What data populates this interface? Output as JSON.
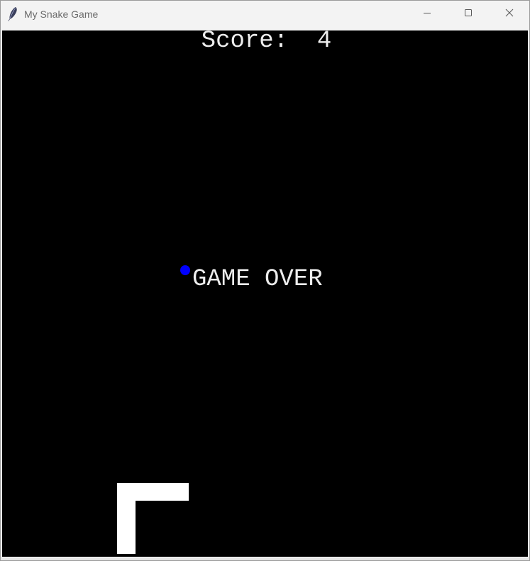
{
  "window": {
    "title": "My Snake Game",
    "app_icon": "feather-icon",
    "controls": {
      "minimize_icon": "minimize-icon",
      "maximize_icon": "maximize-icon",
      "close_icon": "close-icon"
    }
  },
  "game": {
    "score_text": "Score:  4",
    "game_over_text": "GAME OVER",
    "food_color": "#0000ff",
    "snake_color": "#ffffff",
    "background_color": "#000000",
    "text_color": "#ededed"
  }
}
